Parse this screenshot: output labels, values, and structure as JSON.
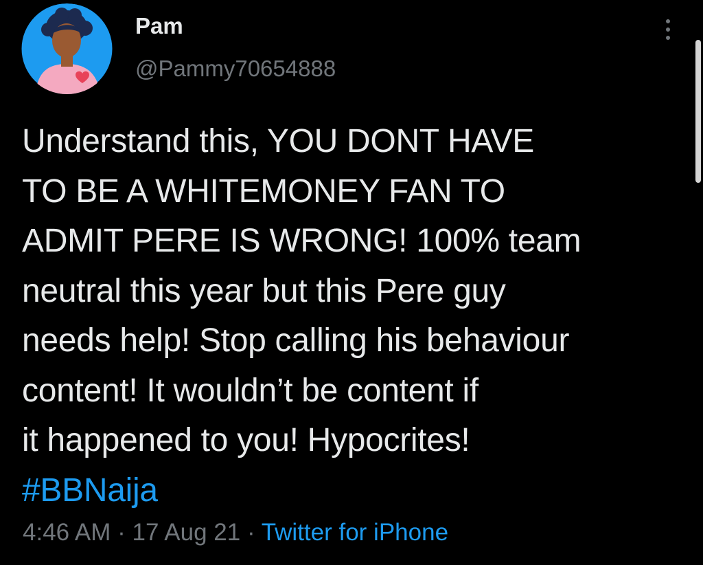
{
  "tweet": {
    "author": {
      "display_name": "Pam",
      "handle": "@Pammy70654888",
      "avatar_icon": "avatar-icon"
    },
    "more_icon": "more-options-icon",
    "text_lines": [
      "Understand this, YOU DONT HAVE",
      "TO BE A WHITEMONEY FAN TO",
      "ADMIT PERE IS WRONG! 100% team",
      "neutral this year but this Pere guy",
      "needs help! Stop calling his behaviour",
      "content! It wouldn’t be content if",
      "it happened to you! Hypocrites!"
    ],
    "hashtag": "#BBNaija",
    "time": "4:46 AM",
    "separator": "·",
    "date": "17 Aug 21",
    "source": "Twitter for iPhone"
  },
  "colors": {
    "background": "#000000",
    "text_primary": "#e7e9ea",
    "text_secondary": "#71767b",
    "link": "#1d9bf0",
    "avatar_bg": "#1d9bf0",
    "avatar_shirt": "#f4a9c0",
    "avatar_heart": "#e8425a",
    "avatar_skin": "#9a5a32",
    "avatar_hair": "#1c2a4f"
  }
}
